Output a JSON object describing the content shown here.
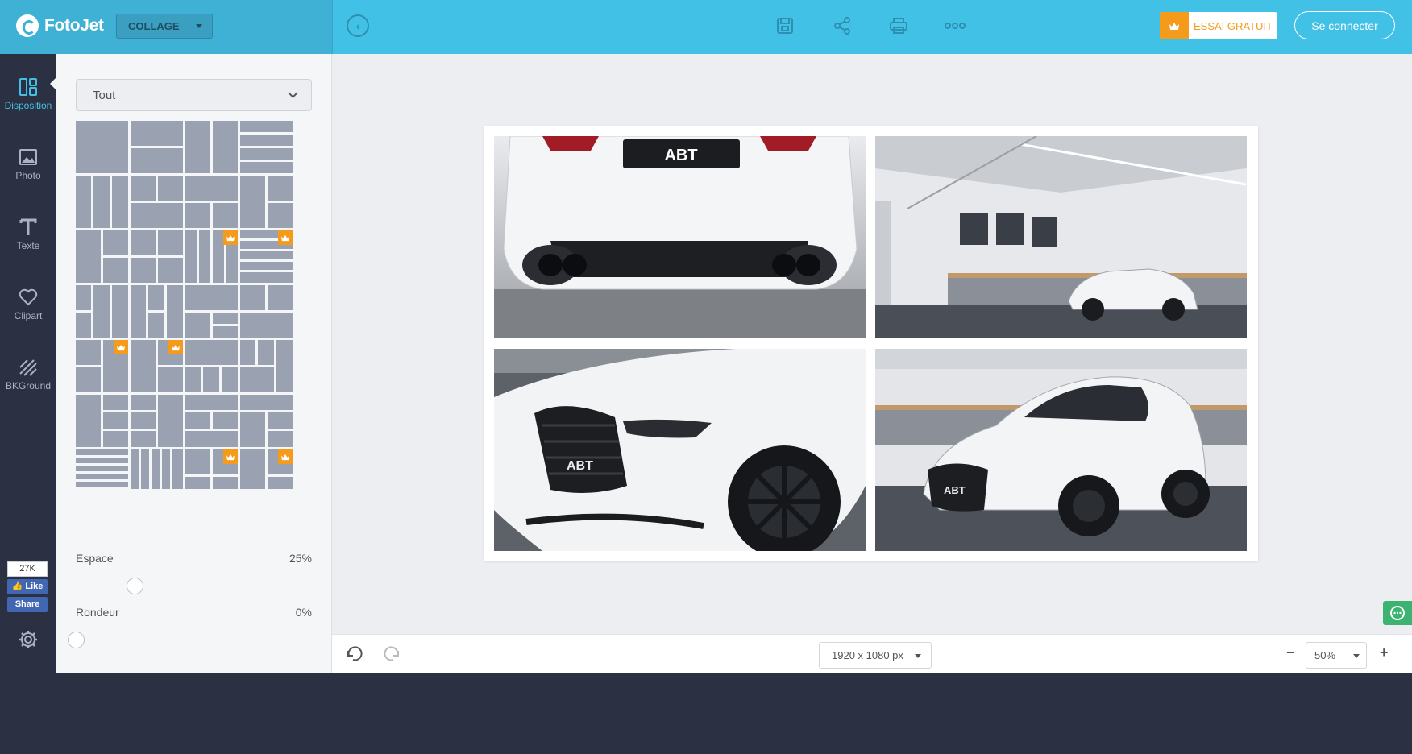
{
  "app": {
    "logo_text": "FotoJet",
    "mode": "COLLAGE"
  },
  "toolbar": {
    "icons": [
      "back-icon",
      "save-icon",
      "share-icon",
      "print-icon",
      "more-icon"
    ],
    "trial_label": "ESSAI GRATUIT",
    "login_label": "Se connecter"
  },
  "rail": {
    "items": [
      {
        "label": "Disposition",
        "icon": "layout-icon",
        "active": true
      },
      {
        "label": "Photo",
        "icon": "photo-icon",
        "active": false
      },
      {
        "label": "Texte",
        "icon": "text-icon",
        "active": false
      },
      {
        "label": "Clipart",
        "icon": "heart-icon",
        "active": false
      },
      {
        "label": "BKGround",
        "icon": "background-icon",
        "active": false
      }
    ],
    "facebook": {
      "count": "27K",
      "like_label": "Like",
      "share_label": "Share"
    }
  },
  "panel": {
    "filter_value": "Tout",
    "layouts_count": 28,
    "premium_layouts": [
      10,
      11,
      16,
      17,
      26,
      27
    ],
    "spacing": {
      "label": "Espace",
      "value": "25%",
      "fraction": 0.25
    },
    "roundness": {
      "label": "Rondeur",
      "value": "0%",
      "fraction": 0.0
    }
  },
  "canvas": {
    "photos": [
      {
        "name": "audi-rear-photo",
        "subject": "white ABT RS3 rear view"
      },
      {
        "name": "audi-garage-photo",
        "subject": "white ABT RS3 in garage"
      },
      {
        "name": "audi-front-closeup-photo",
        "subject": "white ABT RS3 front closeup"
      },
      {
        "name": "audi-front-three-quarter-photo",
        "subject": "white ABT RS3 front three-quarter"
      }
    ]
  },
  "bottom": {
    "canvas_size": "1920 x 1080 px",
    "zoom": "50%"
  },
  "colors": {
    "topbar": "#42c1e6",
    "accent": "#42c1e6",
    "premium": "#f59b1c",
    "rail": "#2b3142",
    "tile": "#9aa1b0"
  }
}
